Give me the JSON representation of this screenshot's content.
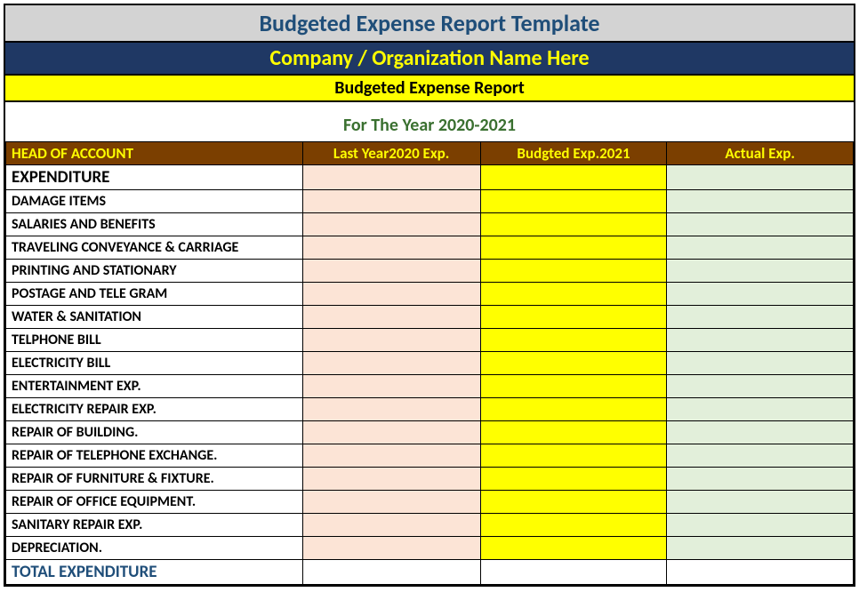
{
  "header": {
    "template_title": "Budgeted Expense Report Template",
    "company_placeholder": "Company / Organization Name Here",
    "report_title": "Budgeted Expense Report",
    "year_line": "For The Year 2020-2021"
  },
  "columns": {
    "account": "HEAD OF ACCOUNT",
    "last_year": "Last Year2020 Exp.",
    "budgeted": "Budgted Exp.2021",
    "actual": "Actual Exp."
  },
  "section_header": "EXPENDITURE",
  "rows": [
    {
      "label": "DAMAGE ITEMS",
      "last": "",
      "budget": "",
      "actual": ""
    },
    {
      "label": "SALARIES AND BENEFITS",
      "last": "",
      "budget": "",
      "actual": ""
    },
    {
      "label": "TRAVELING CONVEYANCE & CARRIAGE",
      "last": "",
      "budget": "",
      "actual": ""
    },
    {
      "label": "PRINTING AND STATIONARY",
      "last": "",
      "budget": "",
      "actual": ""
    },
    {
      "label": "POSTAGE AND TELE GRAM",
      "last": "",
      "budget": "",
      "actual": ""
    },
    {
      "label": "WATER & SANITATION",
      "last": "",
      "budget": "",
      "actual": ""
    },
    {
      "label": "TELPHONE BILL",
      "last": "",
      "budget": "",
      "actual": ""
    },
    {
      "label": "ELECTRICITY BILL",
      "last": "",
      "budget": "",
      "actual": ""
    },
    {
      "label": "ENTERTAINMENT EXP.",
      "last": "",
      "budget": "",
      "actual": ""
    },
    {
      "label": "ELECTRICITY REPAIR EXP.",
      "last": "",
      "budget": "",
      "actual": ""
    },
    {
      "label": "REPAIR OF BUILDING.",
      "last": "",
      "budget": "",
      "actual": ""
    },
    {
      "label": "REPAIR OF TELEPHONE EXCHANGE.",
      "last": "",
      "budget": "",
      "actual": ""
    },
    {
      "label": "REPAIR OF FURNITURE & FIXTURE.",
      "last": "",
      "budget": "",
      "actual": ""
    },
    {
      "label": "REPAIR OF OFFICE EQUIPMENT.",
      "last": "",
      "budget": "",
      "actual": ""
    },
    {
      "label": "SANITARY REPAIR EXP.",
      "last": "",
      "budget": "",
      "actual": ""
    },
    {
      "label": "DEPRECIATION.",
      "last": "",
      "budget": "",
      "actual": ""
    }
  ],
  "total_label": "TOTAL EXPENDITURE",
  "colors": {
    "title_bg": "#d3d3d3",
    "title_fg": "#1f4e79",
    "company_bg": "#1f3864",
    "company_fg": "#ffff00",
    "report_title_bg": "#ffff00",
    "year_fg": "#3a7030",
    "header_row_bg": "#7b3f00",
    "header_row_fg": "#ffff00",
    "last_year_cell": "#fce4d6",
    "budgeted_cell": "#ffff00",
    "actual_cell": "#e2efda"
  }
}
